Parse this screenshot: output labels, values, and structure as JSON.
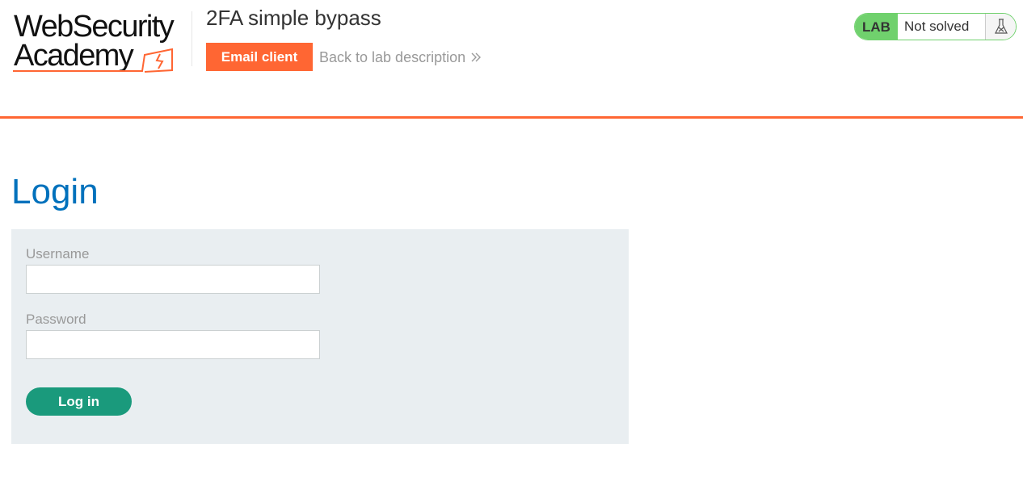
{
  "logo": {
    "line1": "WebSecurity",
    "line2": "Academy",
    "icon": "web-security-academy-logo-icon"
  },
  "header": {
    "lab_title": "2FA simple bypass",
    "email_client_label": "Email client",
    "back_link_label": "Back to lab description",
    "back_link_icon": "double-chevron-right-icon"
  },
  "status": {
    "badge": "LAB",
    "text": "Not solved",
    "icon": "flask-icon"
  },
  "main": {
    "title": "Login",
    "form": {
      "username_label": "Username",
      "username_value": "",
      "password_label": "Password",
      "password_value": "",
      "submit_label": "Log in"
    }
  },
  "colors": {
    "accent": "#ff6633",
    "title_blue": "#0071bc",
    "lab_green": "#70d16d",
    "button_green": "#1a9a7c",
    "panel_bg": "#e9eef1"
  }
}
